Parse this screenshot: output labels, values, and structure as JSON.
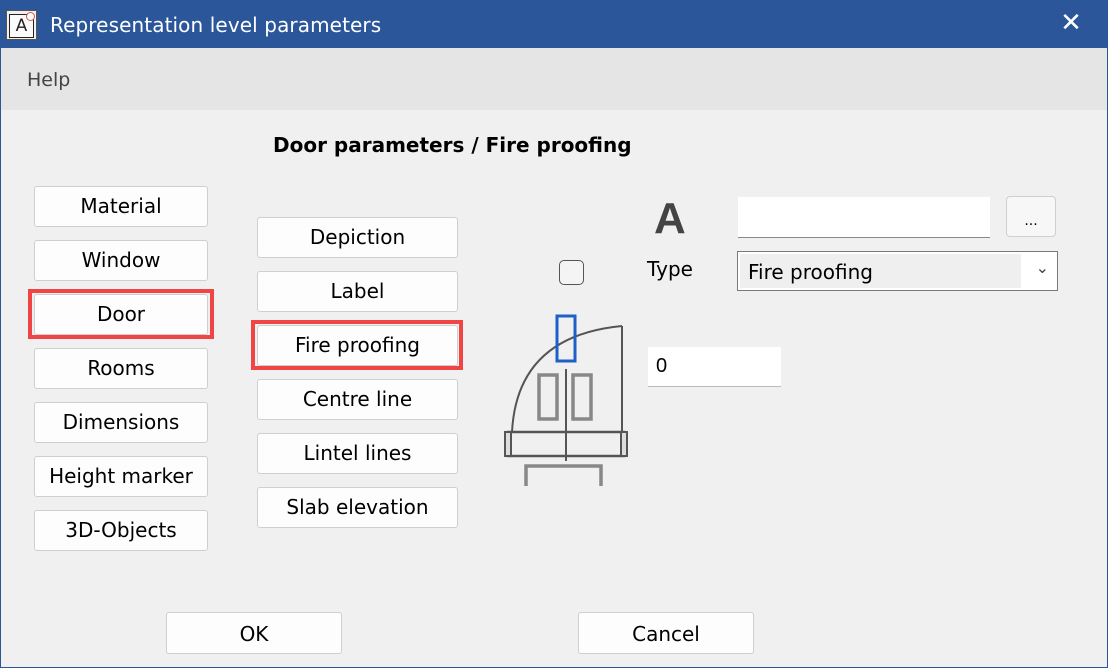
{
  "window": {
    "title": "Representation level parameters",
    "app_icon": "app-a-icon",
    "close_icon": "close-icon",
    "close_glyph": "✕"
  },
  "menu": {
    "items": [
      {
        "label": "Help"
      }
    ]
  },
  "heading": "Door parameters / Fire proofing",
  "categories": {
    "selected": "Door",
    "items": [
      {
        "label": "Material"
      },
      {
        "label": "Window"
      },
      {
        "label": "Door"
      },
      {
        "label": "Rooms"
      },
      {
        "label": "Dimensions"
      },
      {
        "label": "Height marker"
      },
      {
        "label": "3D-Objects"
      }
    ]
  },
  "subcategories": {
    "selected": "Fire proofing",
    "items": [
      {
        "label": "Depiction"
      },
      {
        "label": "Label"
      },
      {
        "label": "Fire proofing"
      },
      {
        "label": "Centre line"
      },
      {
        "label": "Lintel lines"
      },
      {
        "label": "Slab elevation"
      }
    ]
  },
  "preview": {
    "checkbox_checked": false,
    "highlight_color": "#1f5fc8"
  },
  "text_style": {
    "font_glyph": "A",
    "font_value": "",
    "browse_label": "..."
  },
  "type": {
    "label": "Type",
    "value": "Fire proofing",
    "chevron": "⌵"
  },
  "value_field": "0",
  "footer": {
    "ok_label": "OK",
    "cancel_label": "Cancel"
  },
  "colors": {
    "titlebar": "#2b579a",
    "selection_frame": "#f04545"
  }
}
